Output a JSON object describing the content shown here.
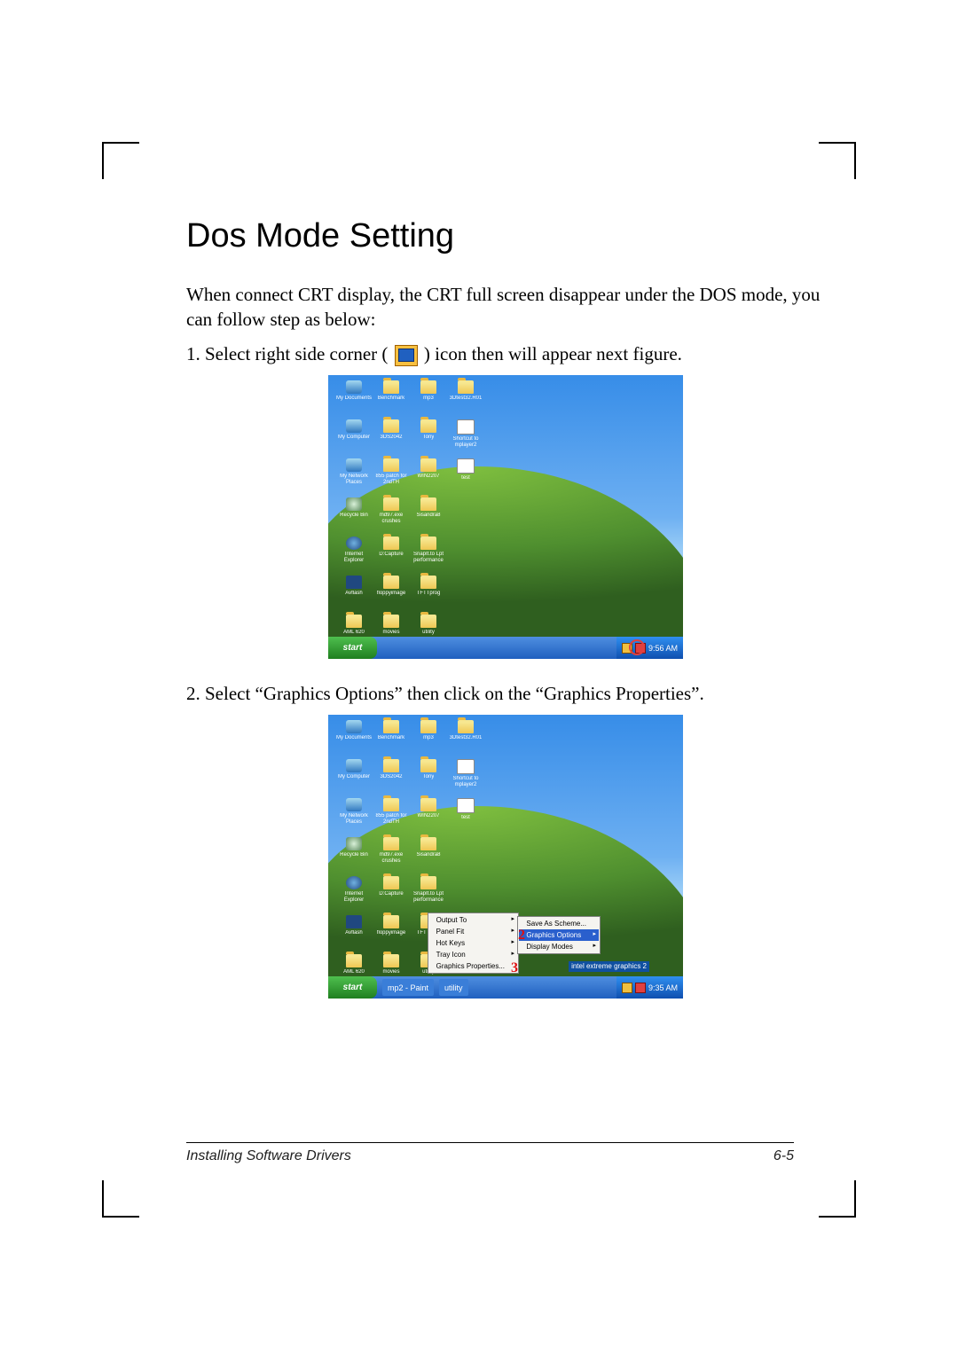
{
  "heading": "Dos Mode Setting",
  "intro": "When connect CRT display, the CRT full screen disappear under the DOS mode, you can follow step as below:",
  "step1_pre": "1. Select right side corner (",
  "step1_post": ") icon then will appear next figure.",
  "step2": "2. Select “Graphics Options” then click on the “Graphics Properties”.",
  "footer_left": "Installing Software Drivers",
  "footer_right": "6-5",
  "winxp": {
    "start": "start",
    "clock1": "9:56 AM",
    "clock2": "9:35 AM",
    "taskbar_apps": [
      "mp2 - Paint",
      "utility"
    ],
    "icons": [
      {
        "label": "My Documents",
        "type": "sys"
      },
      {
        "label": "Benchmark",
        "type": "folder"
      },
      {
        "label": "mp3",
        "type": "folder"
      },
      {
        "label": "3Dtest32.R01",
        "type": "folder"
      },
      {
        "label": "My Computer",
        "type": "sys"
      },
      {
        "label": "3DS2042",
        "type": "folder"
      },
      {
        "label": "Tony",
        "type": "folder"
      },
      {
        "label": "Shortcut to mplayer2",
        "type": "doc"
      },
      {
        "label": "My Network Places",
        "type": "sys"
      },
      {
        "label": "855 patch for 2ndTH",
        "type": "folder"
      },
      {
        "label": "WIN2207",
        "type": "folder"
      },
      {
        "label": "test",
        "type": "doc"
      },
      {
        "label": "Recycle Bin",
        "type": "bin"
      },
      {
        "label": "md97.exe crushes",
        "type": "folder"
      },
      {
        "label": "Sisandra8",
        "type": "folder"
      },
      {
        "label": "",
        "type": "none"
      },
      {
        "label": "Internet Explorer",
        "type": "ie"
      },
      {
        "label": "D:Capture",
        "type": "folder"
      },
      {
        "label": "SnapIt.to Lpt performance",
        "type": "folder"
      },
      {
        "label": "",
        "type": "none"
      },
      {
        "label": "Avflash",
        "type": "av"
      },
      {
        "label": "floppyimage",
        "type": "folder"
      },
      {
        "label": "TFTTprog",
        "type": "folder"
      },
      {
        "label": "",
        "type": "none"
      },
      {
        "label": "AML 620",
        "type": "folder"
      },
      {
        "label": "movies",
        "type": "folder"
      },
      {
        "label": "utility",
        "type": "folder"
      }
    ],
    "context_menu_1": [
      {
        "label": "Output To",
        "arrow": true
      },
      {
        "label": "Panel Fit",
        "arrow": true
      },
      {
        "label": "Hot Keys",
        "arrow": true
      },
      {
        "label": "Tray Icon",
        "arrow": true
      },
      {
        "label": "Graphics Properties...",
        "arrow": false
      }
    ],
    "context_menu_2": [
      {
        "label": "Save As Scheme...",
        "arrow": false
      },
      {
        "label": "Graphics Options",
        "arrow": true,
        "hilite": true
      },
      {
        "label": "Display Modes",
        "arrow": true
      }
    ],
    "intel_text": "intel\nextreme\ngraphics 2",
    "callout_2": "2",
    "callout_3": "3"
  }
}
